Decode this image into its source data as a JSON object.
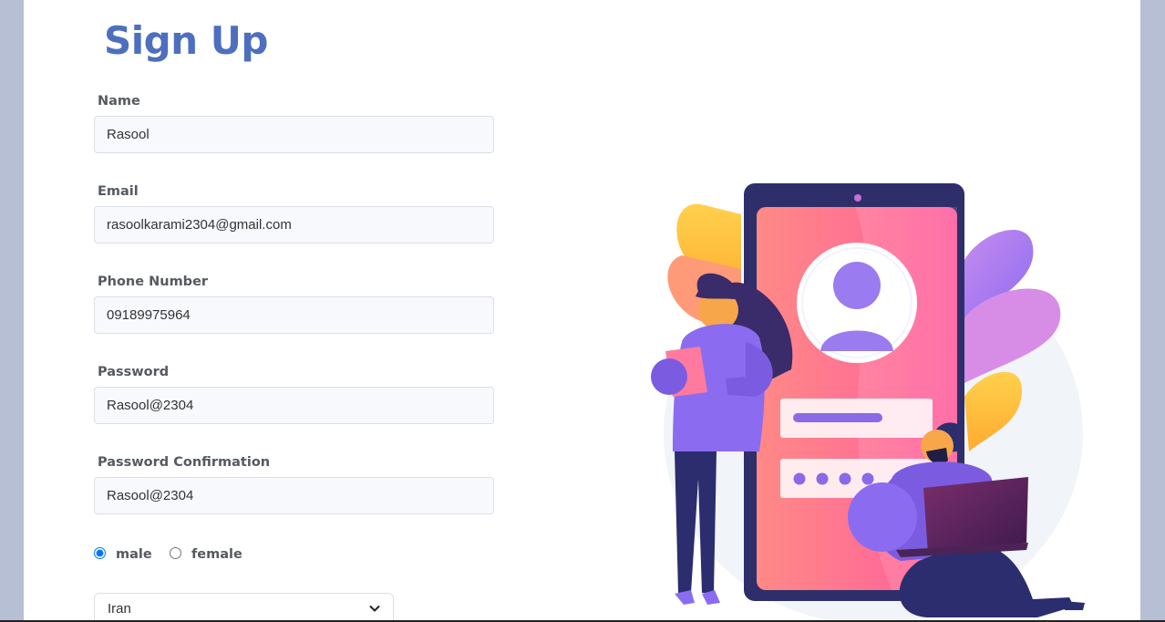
{
  "form": {
    "title": "Sign Up",
    "name": {
      "label": "Name",
      "value": "Rasool"
    },
    "email": {
      "label": "Email",
      "value": "rasoolkarami2304@gmail.com"
    },
    "phone": {
      "label": "Phone Number",
      "value": "09189975964"
    },
    "password": {
      "label": "Password",
      "value": "Rasool@2304"
    },
    "password_confirmation": {
      "label": "Password Confirmation",
      "value": "Rasool@2304"
    },
    "gender": {
      "options": [
        {
          "label": "male",
          "checked": true
        },
        {
          "label": "female",
          "checked": false
        }
      ]
    },
    "country": {
      "selected": "Iran"
    }
  },
  "illustration": {
    "icon": "signup-illustration",
    "colors": {
      "accent": "#4d6fbd",
      "phone_frame": "#2f2f6b",
      "screen_pink": "#ff6b8e",
      "purple": "#8b6cf0",
      "navy": "#2b2d6e",
      "yellow": "#ffc23d"
    }
  }
}
